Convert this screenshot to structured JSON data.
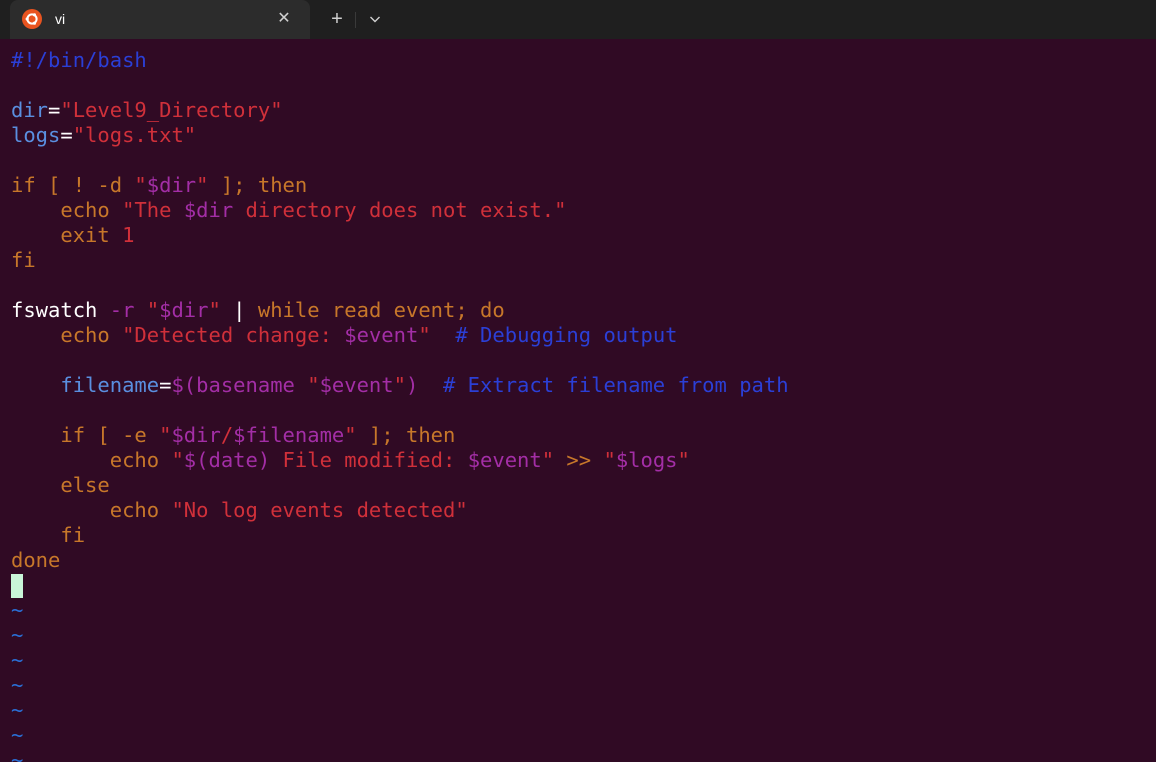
{
  "window": {
    "tab_title": "vi",
    "tab_icon": "ubuntu-icon",
    "close_glyph": "✕",
    "new_tab_glyph": "+",
    "dropdown_icon": "chevron-down-icon"
  },
  "colors": {
    "background": "#300a24",
    "titlebar": "#1f1f1f",
    "tab": "#2c2c2c",
    "shebang": "#2b3fd6",
    "identifier": "#5a8fe0",
    "string": "#d0303a",
    "keyword": "#c7772a",
    "variable": "#a32ea6",
    "comment": "#2b3fd6",
    "plain": "#ffffff",
    "cursor": "#c9f5d8",
    "tilde": "#2a6fd6"
  },
  "editor": {
    "lines": [
      [
        {
          "t": "#!/bin/bash",
          "c": "shebang"
        }
      ],
      [],
      [
        {
          "t": "dir",
          "c": "identifier"
        },
        {
          "t": "=",
          "c": "plain"
        },
        {
          "t": "\"Level9_Directory\"",
          "c": "string"
        }
      ],
      [
        {
          "t": "logs",
          "c": "identifier"
        },
        {
          "t": "=",
          "c": "plain"
        },
        {
          "t": "\"logs.txt\"",
          "c": "string"
        }
      ],
      [],
      [
        {
          "t": "if [ ! -d ",
          "c": "keyword"
        },
        {
          "t": "\"",
          "c": "string"
        },
        {
          "t": "$dir",
          "c": "variable"
        },
        {
          "t": "\"",
          "c": "string"
        },
        {
          "t": " ]; then",
          "c": "keyword"
        }
      ],
      [
        {
          "t": "    echo ",
          "c": "keyword"
        },
        {
          "t": "\"The ",
          "c": "string"
        },
        {
          "t": "$dir",
          "c": "variable"
        },
        {
          "t": " directory does not exist.\"",
          "c": "string"
        }
      ],
      [
        {
          "t": "    exit ",
          "c": "keyword"
        },
        {
          "t": "1",
          "c": "string"
        }
      ],
      [
        {
          "t": "fi",
          "c": "keyword"
        }
      ],
      [],
      [
        {
          "t": "fswatch ",
          "c": "plain"
        },
        {
          "t": "-r",
          "c": "variable"
        },
        {
          "t": " ",
          "c": "plain"
        },
        {
          "t": "\"",
          "c": "string"
        },
        {
          "t": "$dir",
          "c": "variable"
        },
        {
          "t": "\"",
          "c": "string"
        },
        {
          "t": " | ",
          "c": "plain"
        },
        {
          "t": "while read event; do",
          "c": "keyword"
        }
      ],
      [
        {
          "t": "    echo ",
          "c": "keyword"
        },
        {
          "t": "\"Detected change: ",
          "c": "string"
        },
        {
          "t": "$event",
          "c": "variable"
        },
        {
          "t": "\"",
          "c": "string"
        },
        {
          "t": "  # Debugging output",
          "c": "comment"
        }
      ],
      [],
      [
        {
          "t": "    filename",
          "c": "identifier"
        },
        {
          "t": "=",
          "c": "plain"
        },
        {
          "t": "$(basename ",
          "c": "variable"
        },
        {
          "t": "\"",
          "c": "string"
        },
        {
          "t": "$event",
          "c": "variable"
        },
        {
          "t": "\"",
          "c": "string"
        },
        {
          "t": ")",
          "c": "variable"
        },
        {
          "t": "  # Extract filename from path",
          "c": "comment"
        }
      ],
      [],
      [
        {
          "t": "    if [ -e ",
          "c": "keyword"
        },
        {
          "t": "\"",
          "c": "string"
        },
        {
          "t": "$dir",
          "c": "variable"
        },
        {
          "t": "/",
          "c": "string"
        },
        {
          "t": "$filename",
          "c": "variable"
        },
        {
          "t": "\"",
          "c": "string"
        },
        {
          "t": " ]; then",
          "c": "keyword"
        }
      ],
      [
        {
          "t": "        echo ",
          "c": "keyword"
        },
        {
          "t": "\"",
          "c": "string"
        },
        {
          "t": "$(date)",
          "c": "variable"
        },
        {
          "t": " File modified: ",
          "c": "string"
        },
        {
          "t": "$event",
          "c": "variable"
        },
        {
          "t": "\"",
          "c": "string"
        },
        {
          "t": " >> ",
          "c": "keyword"
        },
        {
          "t": "\"",
          "c": "string"
        },
        {
          "t": "$logs",
          "c": "variable"
        },
        {
          "t": "\"",
          "c": "string"
        }
      ],
      [
        {
          "t": "    else",
          "c": "keyword"
        }
      ],
      [
        {
          "t": "        echo ",
          "c": "keyword"
        },
        {
          "t": "\"No log events detected\"",
          "c": "string"
        }
      ],
      [
        {
          "t": "    fi",
          "c": "keyword"
        }
      ],
      [
        {
          "t": "done",
          "c": "keyword"
        }
      ]
    ],
    "tilde_char": "~",
    "tilde_count": 7
  }
}
